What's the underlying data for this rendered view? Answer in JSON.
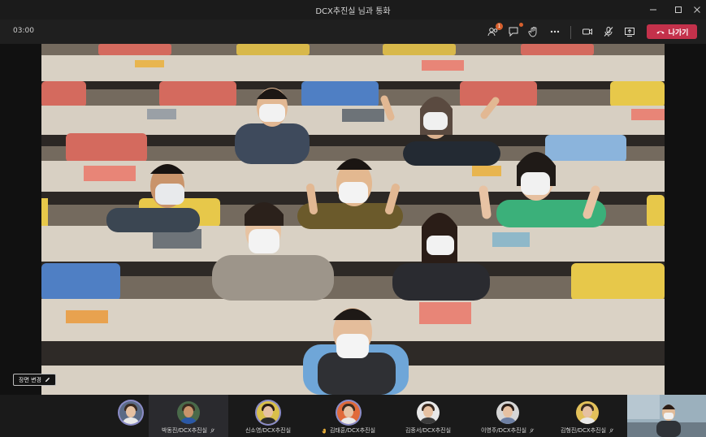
{
  "window": {
    "title": "DCX추진실 님과 통화"
  },
  "toolbar": {
    "timer": "03:00",
    "participants_badge": "1",
    "leave_label": "나가기"
  },
  "video": {
    "change_background_label": "장면 변경"
  },
  "participants": [
    {
      "name": "",
      "status_icon": "none"
    },
    {
      "name": "박동진/DCX추진실",
      "status_icon": "mic-off-icon"
    },
    {
      "name": "신소영/DCX추진실",
      "status_icon": "none"
    },
    {
      "name": "김태훈/DCX추진실",
      "status_icon": "raised-hand-icon"
    },
    {
      "name": "김종서/DCX추진실",
      "status_icon": "none"
    },
    {
      "name": "이영주/DCX추진실",
      "status_icon": "mic-off-icon"
    },
    {
      "name": "김형진/DCX추진실",
      "status_icon": "mic-off-icon"
    }
  ],
  "colors": {
    "leave_red": "#c4314b",
    "accent": "#8b8cc7",
    "badge": "#d7602e"
  }
}
